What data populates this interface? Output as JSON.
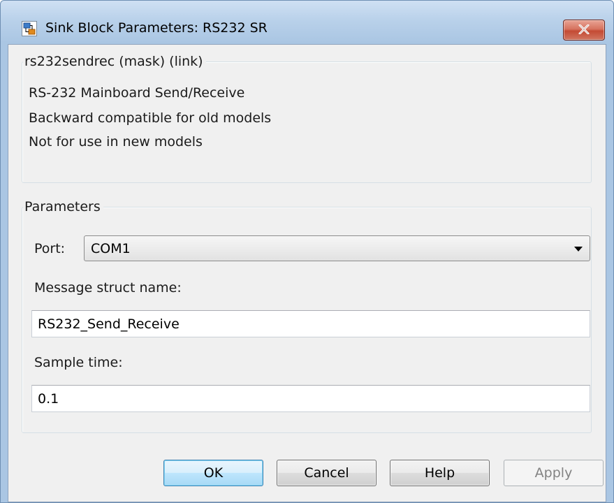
{
  "window": {
    "title": "Sink Block Parameters: RS232 SR",
    "icon": "simulink-block-icon",
    "close_icon": "close-icon",
    "close_color": "#c44b34"
  },
  "mask_group": {
    "label": "rs232sendrec (mask) (link)",
    "description": [
      "RS-232 Mainboard Send/Receive",
      "Backward compatible for old models",
      "Not for use in new models"
    ]
  },
  "parameters_group": {
    "label": "Parameters",
    "port": {
      "label": "Port:",
      "value": "COM1"
    },
    "message_struct_name": {
      "label": "Message struct name:",
      "value": "RS232_Send_Receive"
    },
    "sample_time": {
      "label": "Sample time:",
      "value": "0.1"
    }
  },
  "buttons": {
    "ok": "OK",
    "cancel": "Cancel",
    "help": "Help",
    "apply": "Apply"
  }
}
